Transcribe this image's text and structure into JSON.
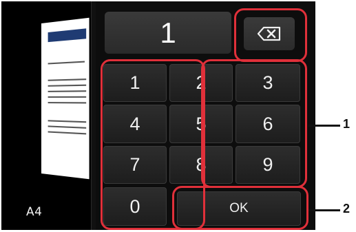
{
  "display": {
    "value": "1"
  },
  "keypad": {
    "digits": [
      "1",
      "2",
      "3",
      "4",
      "5",
      "6",
      "7",
      "8",
      "9",
      "0"
    ],
    "ok_label": "OK",
    "backspace_icon": "backspace-icon"
  },
  "preview": {
    "paper_size": "A4"
  },
  "callouts": [
    "1",
    "2"
  ],
  "colors": {
    "highlight": "#e0303a",
    "screen_bg": "#0d0d0d",
    "key_bg": "#262626"
  }
}
